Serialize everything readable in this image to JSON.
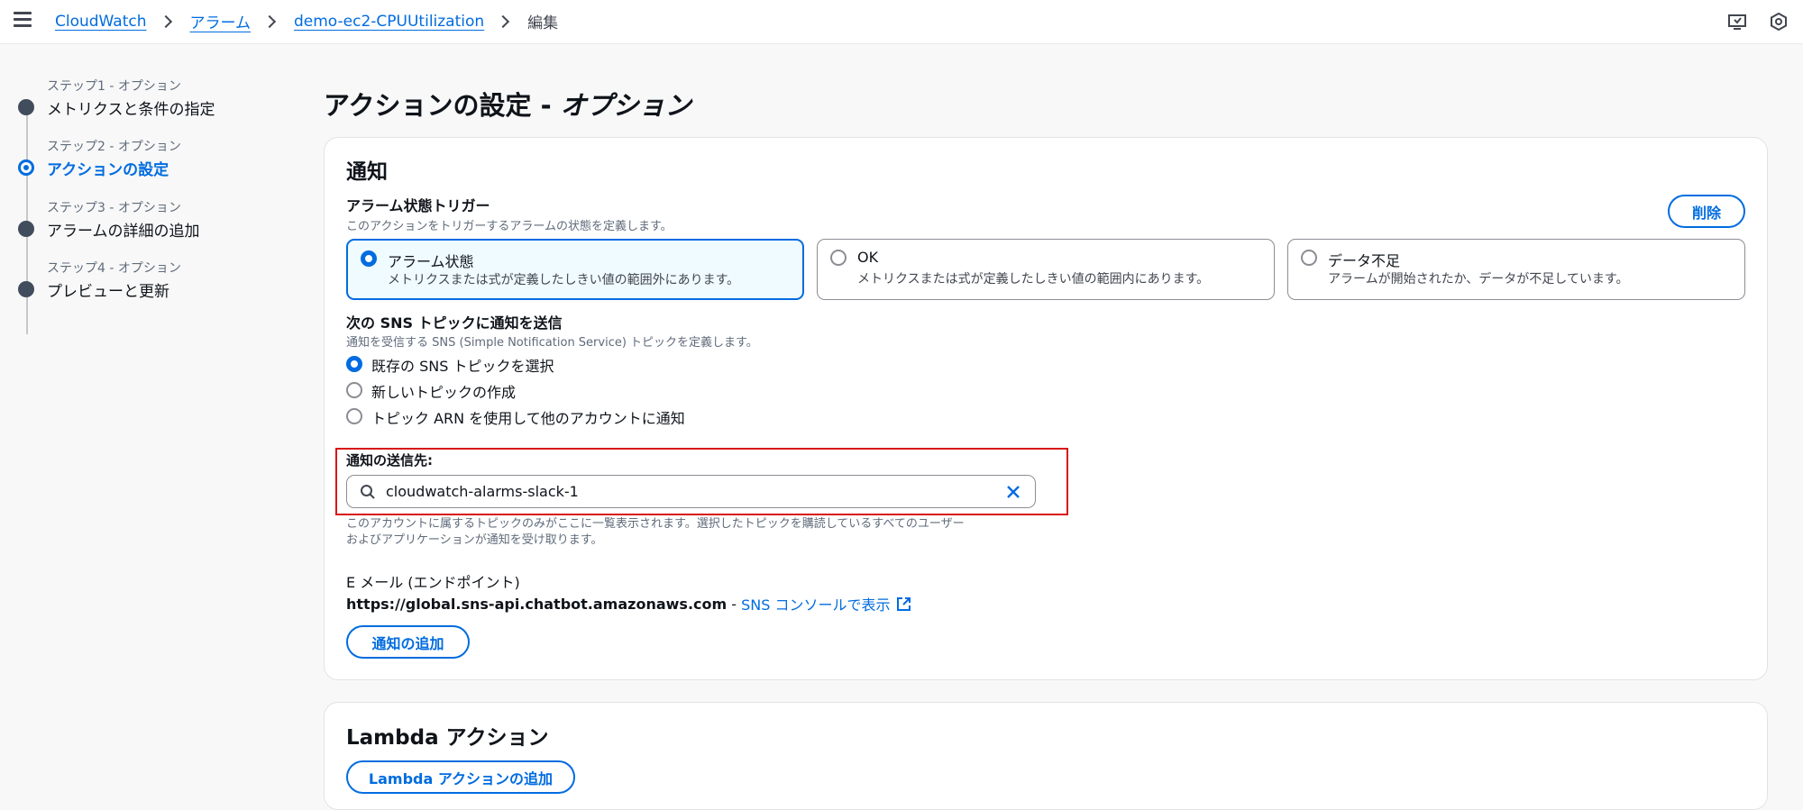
{
  "breadcrumb": {
    "items": [
      "CloudWatch",
      "アラーム",
      "demo-ec2-CPUUtilization"
    ],
    "current": "編集"
  },
  "steps": [
    {
      "num": "ステップ1 - オプション",
      "name": "メトリクスと条件の指定",
      "active": false
    },
    {
      "num": "ステップ2 - オプション",
      "name": "アクションの設定",
      "active": true
    },
    {
      "num": "ステップ3 - オプション",
      "name": "アラームの詳細の追加",
      "active": false
    },
    {
      "num": "ステップ4 - オプション",
      "name": "プレビューと更新",
      "active": false
    }
  ],
  "page": {
    "title": "アクションの設定 - ",
    "title_italic": "オプション"
  },
  "notification": {
    "title": "通知",
    "trigger_label": "アラーム状態トリガー",
    "trigger_desc": "このアクションをトリガーするアラームの状態を定義します。",
    "delete_button": "削除",
    "tiles": [
      {
        "label": "アラーム状態",
        "desc": "メトリクスまたは式が定義したしきい値の範囲外にあります。",
        "selected": true
      },
      {
        "label": "OK",
        "desc": "メトリクスまたは式が定義したしきい値の範囲内にあります。",
        "selected": false
      },
      {
        "label": "データ不足",
        "desc": "アラームが開始されたか、データが不足しています。",
        "selected": false
      }
    ],
    "sns_label": "次の SNS トピックに通知を送信",
    "sns_desc": "通知を受信する SNS (Simple Notification Service) トピックを定義します。",
    "sns_options": [
      {
        "label": "既存の SNS トピックを選択",
        "selected": true
      },
      {
        "label": "新しいトピックの作成",
        "selected": false
      },
      {
        "label": "トピック ARN を使用して他のアカウントに通知",
        "selected": false
      }
    ],
    "send_to_label": "通知の送信先:",
    "send_to_value": "cloudwatch-alarms-slack-1",
    "help_line1": "このアカウントに属するトピックのみがここに一覧表示されます。選択したトピックを購読しているすべてのユーザー",
    "help_line2": "およびアプリケーションが通知を受け取ります。",
    "email_label": "E メール (エンドポイント)",
    "email_endpoint": "https://global.sns-api.chatbot.amazonaws.com",
    "email_sep": " - ",
    "email_link": "SNS コンソールで表示",
    "add_button": "通知の追加"
  },
  "lambda": {
    "title": "Lambda アクション",
    "add_button": "Lambda アクションの追加"
  },
  "colors": {
    "accent": "#006ce0",
    "highlight": "#d91515"
  },
  "icons": [
    "menu-icon",
    "chevron-right-icon",
    "monitor-icon",
    "settings-icon",
    "search-icon",
    "clear-icon",
    "external-link-icon"
  ]
}
